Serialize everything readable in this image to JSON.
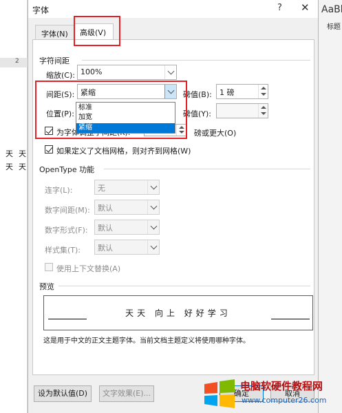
{
  "dialog": {
    "title": "字体",
    "help_icon": "?",
    "close_icon": "✕"
  },
  "background": {
    "ribbon_preview": "AaBb",
    "style_label": "标题",
    "ruler_mark": "2",
    "doc_chars": [
      "天",
      "天",
      "天",
      "天"
    ]
  },
  "tabs": [
    {
      "label": "字体(N)",
      "active": false
    },
    {
      "label": "高级(V)",
      "active": true
    }
  ],
  "spacing_section": {
    "title": "字符间距",
    "scale_label": "缩放(C):",
    "scale_value": "100%",
    "spacing_label": "间距(S):",
    "spacing_value": "紧缩",
    "spacing_options": [
      "标准",
      "加宽",
      "紧缩"
    ],
    "spacing_selected": "紧缩",
    "spacing_pts_label": "磅值(B):",
    "spacing_pts_value": "1 磅",
    "position_label": "位置(P):",
    "position_pts_label": "磅值(Y):",
    "position_pts_value": "",
    "kerning_label": "为字体调整字间距(K):",
    "kerning_checked": true,
    "kerning_suffix": "磅或更大(O)",
    "grid_label": "如果定义了文档网格，则对齐到网格(W)",
    "grid_checked": true
  },
  "opentype_section": {
    "title": "OpenType 功能",
    "ligatures_label": "连字(L):",
    "ligatures_value": "无",
    "num_spacing_label": "数字间距(M):",
    "num_spacing_value": "默认",
    "num_form_label": "数字形式(F):",
    "num_form_value": "默认",
    "style_set_label": "样式集(T):",
    "style_set_value": "默认",
    "contextual_label": "使用上下文替换(A)"
  },
  "preview_section": {
    "title": "预览",
    "sample": "天天 向上 好好学习",
    "note": "这是用于中文的正文主题字体。当前文档主题定义将使用哪种字体。"
  },
  "buttons": {
    "default_label": "设为默认值(D)",
    "effects_label": "文字效果(E)...",
    "ok_label": "确定",
    "cancel_label": "取消"
  },
  "watermark": {
    "title": "电脑软硬件教程网",
    "url": "www.computer26.com"
  },
  "colors": {
    "highlight_red": "#e81e25",
    "selection_blue": "#0078d7"
  }
}
